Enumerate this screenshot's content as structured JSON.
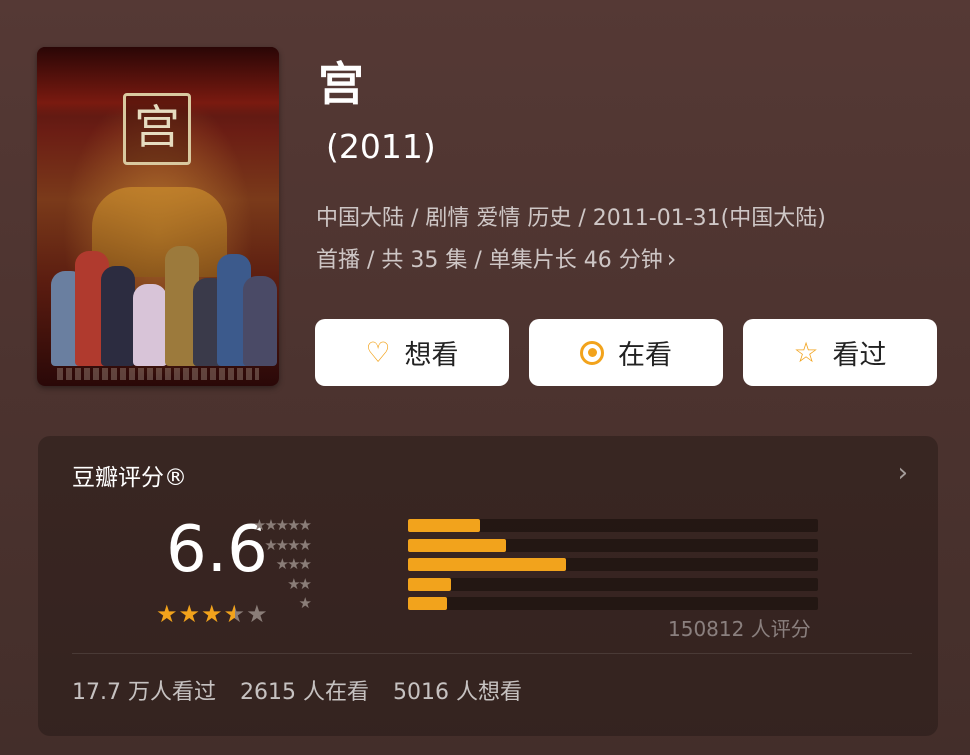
{
  "header": {
    "title": "宫",
    "year": "(2011)",
    "meta_line1": "中国大陆 / 剧情 爱情 历史 / 2011-01-31(中国大陆)",
    "meta_line2": "首播 / 共 35 集 / 单集片长 46 分钟",
    "poster_text": "宫"
  },
  "actions": {
    "want": "想看",
    "watching": "在看",
    "watched": "看过"
  },
  "rating": {
    "title": "豆瓣评分®",
    "score": "6.6",
    "stars_value": 3.3,
    "distribution": [
      {
        "stars": "★★★★★",
        "percent": 17.5
      },
      {
        "stars": "★★★★",
        "percent": 24.0
      },
      {
        "stars": "★★★",
        "percent": 38.5
      },
      {
        "stars": "★★",
        "percent": 10.5
      },
      {
        "stars": "★",
        "percent": 9.5
      }
    ],
    "count_text": "150812 人评分"
  },
  "stats": {
    "watched": "17.7 万人看过",
    "watching": "2615 人在看",
    "want": "5016 人想看"
  },
  "colors": {
    "accent": "#f2a31c",
    "bg": "#4c332f"
  }
}
